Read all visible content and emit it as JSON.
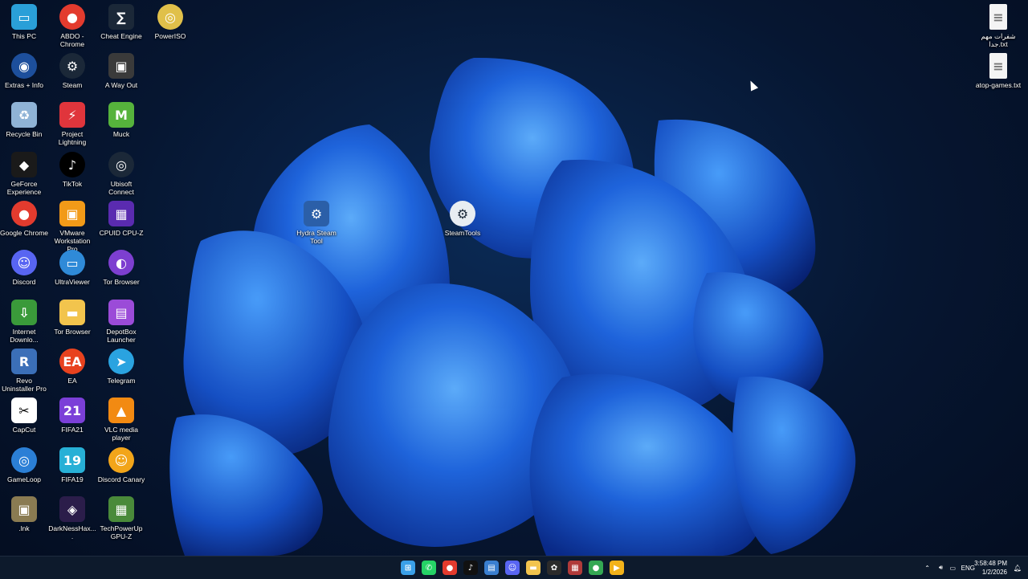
{
  "desktop_icons": [
    {
      "label": "This PC",
      "icon": "monitor-icon",
      "color": "#2a9fd8",
      "glyph": "▭"
    },
    {
      "label": "Extras + Info",
      "icon": "globe-icon",
      "color": "#1d4f9c",
      "glyph": "◉"
    },
    {
      "label": "Recycle Bin",
      "icon": "recycle-bin-icon",
      "color": "#8fb3d6",
      "glyph": "♻"
    },
    {
      "label": "GeForce Experience",
      "icon": "nvidia-icon",
      "color": "#1a1a1a",
      "glyph": "◆"
    },
    {
      "label": "Google Chrome",
      "icon": "chrome-icon",
      "color": "#e33b2e",
      "glyph": "●"
    },
    {
      "label": "Discord",
      "icon": "discord-icon",
      "color": "#5865f2",
      "glyph": "☺"
    },
    {
      "label": "Internet Downlo...",
      "icon": "idm-icon",
      "color": "#3a9a3a",
      "glyph": "⇩"
    },
    {
      "label": "Revo Uninstaller Pro",
      "icon": "revo-icon",
      "color": "#3b6fb8",
      "glyph": "R"
    },
    {
      "label": "CapCut",
      "icon": "capcut-icon",
      "color": "#ffffff",
      "glyph": "✂"
    },
    {
      "label": "GameLoop",
      "icon": "gameloop-icon",
      "color": "#2b7fd6",
      "glyph": "◎"
    },
    {
      "label": ".lnk",
      "icon": "pubg-icon",
      "color": "#8a7b52",
      "glyph": "▣"
    },
    {
      "label": "ABDO - Chrome",
      "icon": "chrome-profile-icon",
      "color": "#e33b2e",
      "glyph": "●"
    },
    {
      "label": "Steam",
      "icon": "steam-icon",
      "color": "#1b2838",
      "glyph": "⚙"
    },
    {
      "label": "Project Lightning",
      "icon": "lightning-icon",
      "color": "#e0353c",
      "glyph": "⚡"
    },
    {
      "label": "TikTok",
      "icon": "tiktok-icon",
      "color": "#000000",
      "glyph": "♪"
    },
    {
      "label": "VMware Workstation Pro",
      "icon": "vmware-icon",
      "color": "#f29a18",
      "glyph": "▣"
    },
    {
      "label": "UltraViewer",
      "icon": "ultraviewer-icon",
      "color": "#2f8ad8",
      "glyph": "▭"
    },
    {
      "label": "Tor Browser",
      "icon": "folder-icon",
      "color": "#f2c44d",
      "glyph": "▬"
    },
    {
      "label": "EA",
      "icon": "ea-icon",
      "color": "#e8421e",
      "glyph": "EA"
    },
    {
      "label": "FIFA21",
      "icon": "fifa21-icon",
      "color": "#7b3fd8",
      "glyph": "21"
    },
    {
      "label": "FIFA19",
      "icon": "fifa19-icon",
      "color": "#27b0d6",
      "glyph": "19"
    },
    {
      "label": "DarkNessHax....",
      "icon": "wolf-icon",
      "color": "#2b1d4a",
      "glyph": "◈"
    },
    {
      "label": "Cheat Engine",
      "icon": "cheat-engine-icon",
      "color": "#1b2838",
      "glyph": "∑"
    },
    {
      "label": "A Way Out",
      "icon": "game-cover-icon",
      "color": "#3a3a3a",
      "glyph": "▣"
    },
    {
      "label": "Muck",
      "icon": "muck-icon",
      "color": "#56b33c",
      "glyph": "M"
    },
    {
      "label": "Ubisoft Connect",
      "icon": "ubisoft-icon",
      "color": "#1b2838",
      "glyph": "◎"
    },
    {
      "label": "CPUID CPU-Z",
      "icon": "cpuz-icon",
      "color": "#5a2bb0",
      "glyph": "▦"
    },
    {
      "label": "Tor Browser",
      "icon": "tor-icon",
      "color": "#7d3fd0",
      "glyph": "◐"
    },
    {
      "label": "DepotBox Launcher",
      "icon": "depotbox-icon",
      "color": "#9b4bd8",
      "glyph": "▤"
    },
    {
      "label": "Telegram",
      "icon": "telegram-icon",
      "color": "#2aa3e0",
      "glyph": "➤"
    },
    {
      "label": "VLC media player",
      "icon": "vlc-icon",
      "color": "#f28a12",
      "glyph": "▲"
    },
    {
      "label": "Discord Canary",
      "icon": "discord-canary-icon",
      "color": "#f2a51a",
      "glyph": "☺"
    },
    {
      "label": "TechPowerUp GPU-Z",
      "icon": "gpuz-icon",
      "color": "#4a8a3a",
      "glyph": "▦"
    },
    {
      "label": "PowerISO",
      "icon": "poweriso-icon",
      "color": "#e0c04a",
      "glyph": "◎"
    },
    {
      "label": "Hydra Steam Tool",
      "icon": "hydra-steam-icon",
      "color": "#2b5fa8",
      "glyph": "⚙"
    },
    {
      "label": "SteamTools",
      "icon": "steamtools-icon",
      "color": "#e8edf2",
      "glyph": "⚙"
    },
    {
      "label": "شفرات مهم جدا.txt",
      "icon": "text-file-icon",
      "color": "#f4f4f4",
      "glyph": "≡"
    },
    {
      "label": "atop-games.txt",
      "icon": "text-file-icon",
      "color": "#f4f4f4",
      "glyph": "≡"
    }
  ],
  "taskbar": {
    "apps": [
      {
        "name": "start-button",
        "glyph": "⊞",
        "color": "#3aa0e8"
      },
      {
        "name": "whatsapp-icon",
        "glyph": "✆",
        "color": "#25d366"
      },
      {
        "name": "chrome-icon",
        "glyph": "●",
        "color": "#e33b2e"
      },
      {
        "name": "tiktok-icon",
        "glyph": "♪",
        "color": "#111111"
      },
      {
        "name": "control-panel-icon",
        "glyph": "▤",
        "color": "#3a7fd0"
      },
      {
        "name": "discord-icon",
        "glyph": "☺",
        "color": "#5865f2"
      },
      {
        "name": "file-explorer-icon",
        "glyph": "▬",
        "color": "#f2c44d"
      },
      {
        "name": "chatgpt-icon",
        "glyph": "✿",
        "color": "#2b2b2b"
      },
      {
        "name": "winrar-icon",
        "glyph": "▦",
        "color": "#b03a3a"
      },
      {
        "name": "chrome-profile-icon",
        "glyph": "●",
        "color": "#34a853"
      },
      {
        "name": "media-player-icon",
        "glyph": "▶",
        "color": "#f2b21a"
      }
    ],
    "language": "ENG",
    "time": "3:58:48 PM",
    "date": "1/2/2026"
  }
}
